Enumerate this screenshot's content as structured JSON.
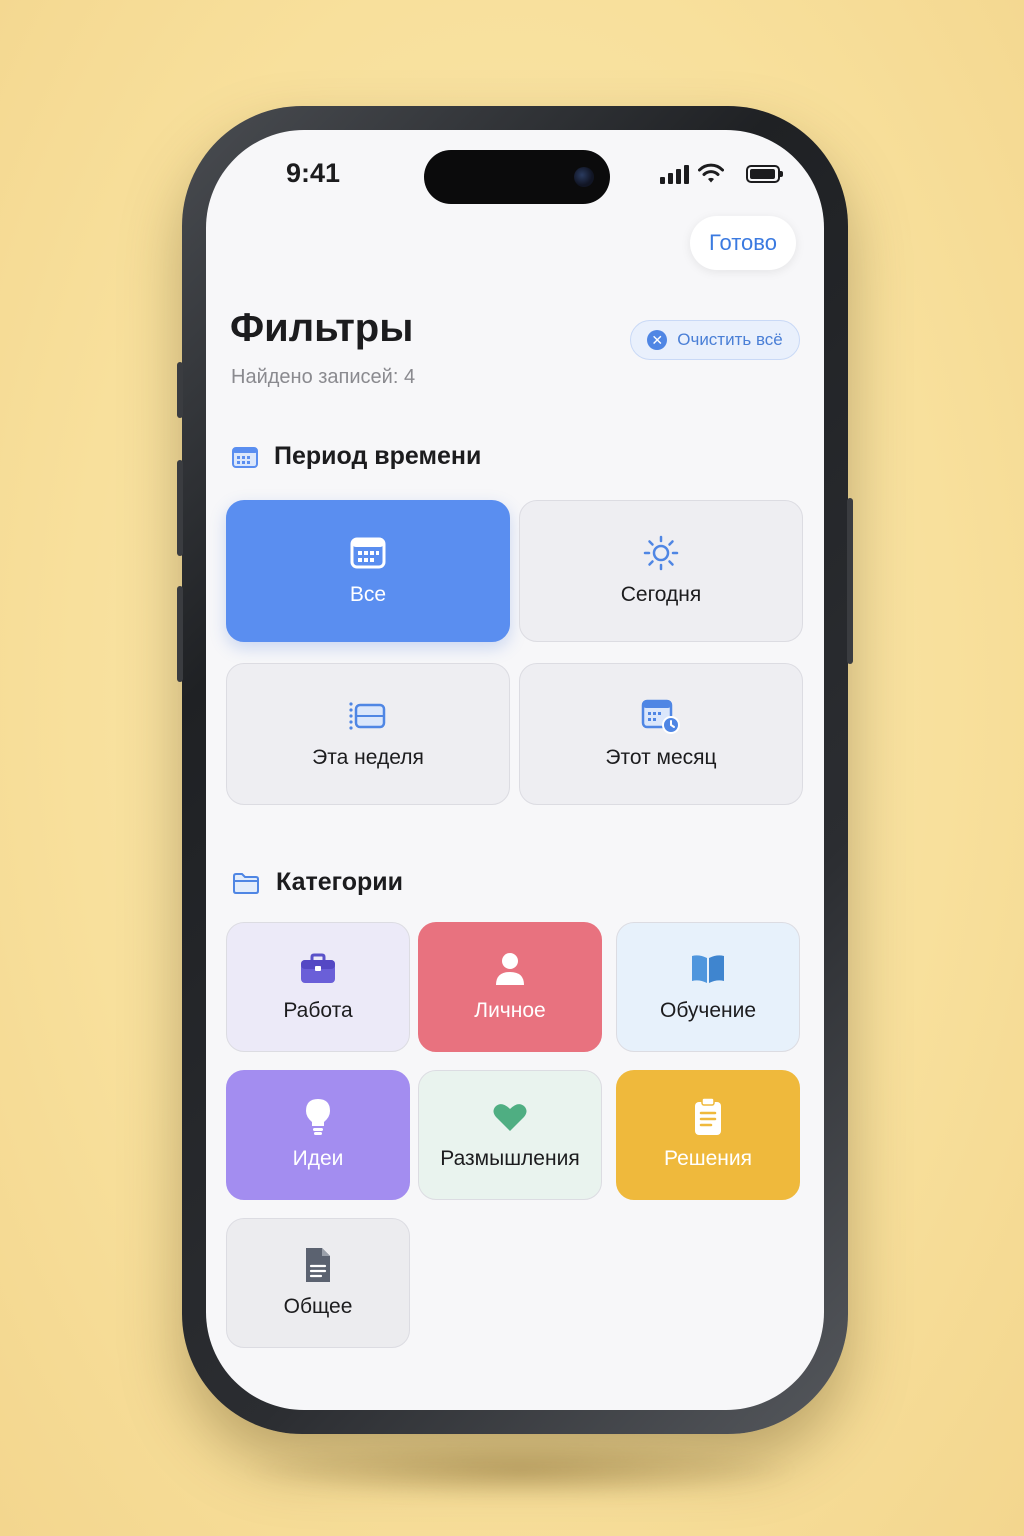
{
  "status_bar": {
    "time": "9:41"
  },
  "header": {
    "done_label": "Готово",
    "title": "Фильтры",
    "records_found": "Найдено записей: 4",
    "clear_all_label": "Очистить всё"
  },
  "time_period": {
    "title": "Период времени",
    "options": [
      {
        "label": "Все",
        "icon": "calendar-icon",
        "selected": true
      },
      {
        "label": "Сегодня",
        "icon": "sun-icon",
        "selected": false
      },
      {
        "label": "Эта неделя",
        "icon": "week-icon",
        "selected": false
      },
      {
        "label": "Этот месяц",
        "icon": "calendar-clock-icon",
        "selected": false
      }
    ]
  },
  "categories": {
    "title": "Категории",
    "items": [
      {
        "label": "Работа",
        "icon": "briefcase-icon",
        "color": "#eceaf8",
        "text_color": "#1c1c1e"
      },
      {
        "label": "Личное",
        "icon": "person-icon",
        "color": "#e8727f",
        "text_color": "#ffffff"
      },
      {
        "label": "Обучение",
        "icon": "book-icon",
        "color": "#e7f1fb",
        "text_color": "#1c1c1e"
      },
      {
        "label": "Идеи",
        "icon": "lightbulb-icon",
        "color": "#a38df0",
        "text_color": "#ffffff"
      },
      {
        "label": "Размышления",
        "icon": "heart-icon",
        "color": "#e9f3ee",
        "text_color": "#1c1c1e"
      },
      {
        "label": "Решения",
        "icon": "clipboard-icon",
        "color": "#efb93c",
        "text_color": "#ffffff"
      },
      {
        "label": "Общее",
        "icon": "document-icon",
        "color": "#ececef",
        "text_color": "#1c1c1e"
      }
    ]
  }
}
